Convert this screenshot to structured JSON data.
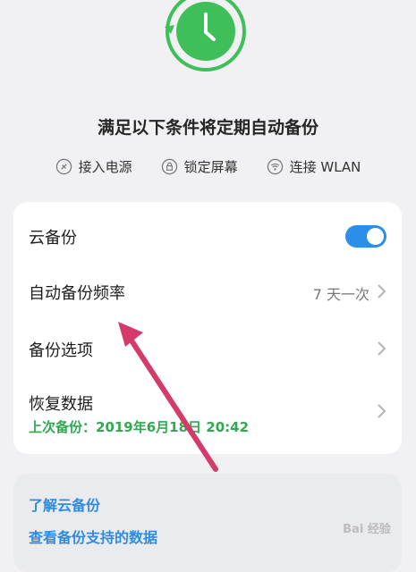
{
  "header": {
    "headline": "满足以下条件将定期自动备份",
    "conditions": [
      {
        "icon": "plug-icon",
        "label": "接入电源"
      },
      {
        "icon": "lock-icon",
        "label": "锁定屏幕"
      },
      {
        "icon": "wifi-icon",
        "label": "连接 WLAN"
      }
    ]
  },
  "settings": {
    "cloud_backup": {
      "label": "云备份",
      "enabled": true
    },
    "frequency": {
      "label": "自动备份频率",
      "value": "7 天一次"
    },
    "options": {
      "label": "备份选项"
    },
    "restore": {
      "label": "恢复数据",
      "last_backup": "上次备份：2019年6月18日 20:42"
    }
  },
  "links": {
    "learn": "了解云备份",
    "view_supported": "查看备份支持的数据"
  },
  "watermark": "Bai 经验",
  "colors": {
    "accent_blue": "#2b8ee8",
    "green": "#32a852",
    "arrow": "#d63a6a"
  }
}
